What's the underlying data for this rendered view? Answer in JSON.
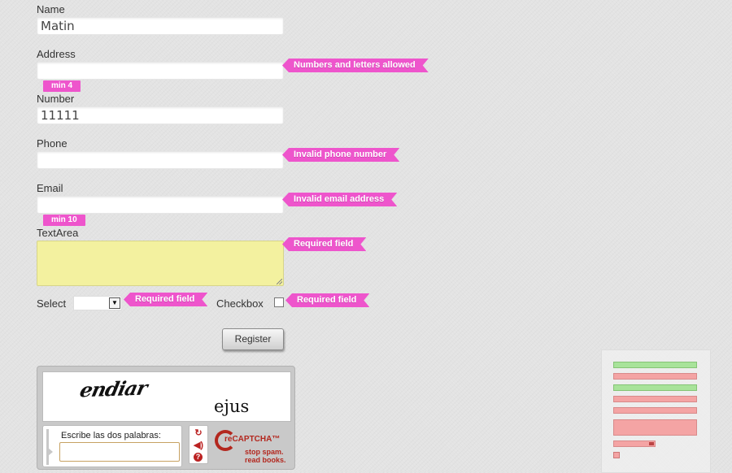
{
  "form": {
    "name_label": "Name",
    "name_value": "Matin",
    "address_label": "Address",
    "address_value": "",
    "number_label": "Number",
    "number_value": "11111",
    "phone_label": "Phone",
    "phone_value": "",
    "email_label": "Email",
    "email_value": "",
    "textarea_label": "TextArea",
    "select_label": "Select",
    "select_value": "",
    "checkbox_label": "Checkbox",
    "register_label": "Register"
  },
  "validation": {
    "address_tip": "Numbers and letters allowed",
    "address_min": "min 4",
    "phone_tip": "Invalid phone number",
    "email_tip": "Invalid email address",
    "email_min": "min 10",
    "textarea_tip": "Required field",
    "select_tip": "Required field",
    "checkbox_tip": "Required field",
    "color": "#ee55cc"
  },
  "captcha": {
    "word1": "endiar",
    "word2": "ejus",
    "prompt": "Escribe las dos palabras:",
    "brand": "reCAPTCHA™",
    "tagline1": "stop spam.",
    "tagline2": "read books.",
    "icons": [
      "refresh-icon",
      "audio-icon",
      "help-icon"
    ]
  },
  "preview": {
    "rows": [
      "valid",
      "invalid",
      "valid",
      "invalid",
      "invalid",
      "invalid-large",
      "invalid-select",
      "invalid-checkbox"
    ]
  }
}
